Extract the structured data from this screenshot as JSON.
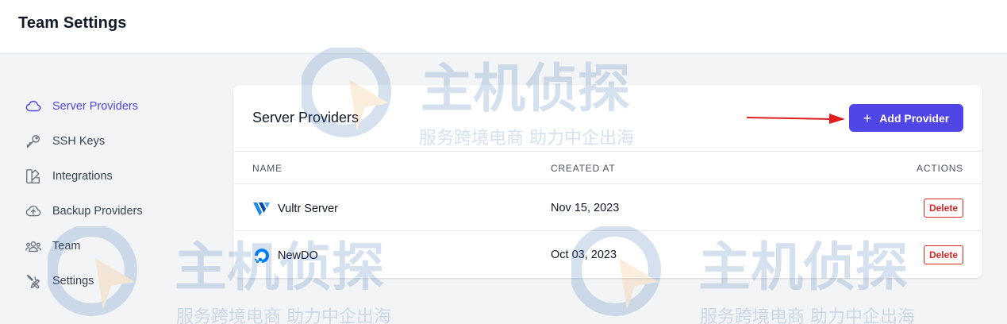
{
  "header": {
    "title": "Team Settings"
  },
  "sidebar": {
    "items": [
      {
        "label": "Server Providers",
        "icon": "cloud-icon",
        "active": true
      },
      {
        "label": "SSH Keys",
        "icon": "key-icon",
        "active": false
      },
      {
        "label": "Integrations",
        "icon": "swatch-icon",
        "active": false
      },
      {
        "label": "Backup Providers",
        "icon": "cloud-upload-icon",
        "active": false
      },
      {
        "label": "Team",
        "icon": "users-icon",
        "active": false
      },
      {
        "label": "Settings",
        "icon": "tools-icon",
        "active": false
      }
    ]
  },
  "main": {
    "title": "Server Providers",
    "add_button": "Add Provider",
    "columns": {
      "name": "NAME",
      "created_at": "CREATED AT",
      "actions": "ACTIONS"
    },
    "rows": [
      {
        "name": "Vultr Server",
        "created_at": "Nov 15, 2023",
        "action": "Delete",
        "logo": "vultr-logo-icon"
      },
      {
        "name": "NewDO",
        "created_at": "Oct 03, 2023",
        "action": "Delete",
        "logo": "digitalocean-logo-icon"
      }
    ]
  },
  "watermark": {
    "title": "主机侦探",
    "subtitle": "服务跨境电商 助力中企出海"
  },
  "colors": {
    "accent": "#4f46e5",
    "danger": "#dc2626",
    "background": "#f3f4f6",
    "arrow": "#e11d1d"
  }
}
